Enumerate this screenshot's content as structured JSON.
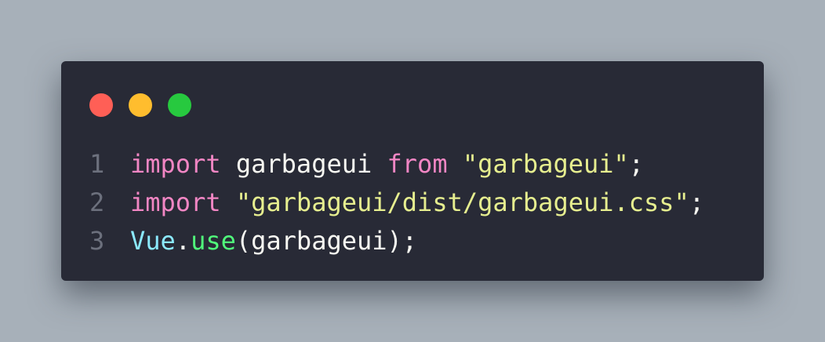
{
  "colors": {
    "background": "#a7b0b9",
    "window": "#282a36",
    "line_number": "#6c707d",
    "keyword": "#f286c4",
    "string": "#e6ee8f",
    "plain": "#f8f8f2",
    "type": "#8be9fd",
    "function": "#50fa7b",
    "dot_close": "#ff5f56",
    "dot_minimize": "#ffbd2e",
    "dot_maximize": "#27c93f"
  },
  "window_controls": [
    {
      "name": "close",
      "icon": "close-dot-icon",
      "color": "#ff5f56"
    },
    {
      "name": "minimize",
      "icon": "minimize-dot-icon",
      "color": "#ffbd2e"
    },
    {
      "name": "maximize",
      "icon": "maximize-dot-icon",
      "color": "#27c93f"
    }
  ],
  "code": {
    "lines": [
      {
        "number": "1",
        "tokens": [
          {
            "text": "import",
            "kind": "keyword"
          },
          {
            "text": " ",
            "kind": "plain"
          },
          {
            "text": "garbageui",
            "kind": "plain"
          },
          {
            "text": " ",
            "kind": "plain"
          },
          {
            "text": "from",
            "kind": "keyword"
          },
          {
            "text": " ",
            "kind": "plain"
          },
          {
            "text": "\"garbageui\"",
            "kind": "string"
          },
          {
            "text": ";",
            "kind": "plain"
          }
        ]
      },
      {
        "number": "2",
        "tokens": [
          {
            "text": "import",
            "kind": "keyword"
          },
          {
            "text": " ",
            "kind": "plain"
          },
          {
            "text": "\"garbageui/dist/garbageui.css\"",
            "kind": "string"
          },
          {
            "text": ";",
            "kind": "plain"
          }
        ]
      },
      {
        "number": "3",
        "tokens": [
          {
            "text": "Vue",
            "kind": "type"
          },
          {
            "text": ".",
            "kind": "plain"
          },
          {
            "text": "use",
            "kind": "function"
          },
          {
            "text": "(garbageui);",
            "kind": "plain"
          }
        ]
      }
    ]
  }
}
